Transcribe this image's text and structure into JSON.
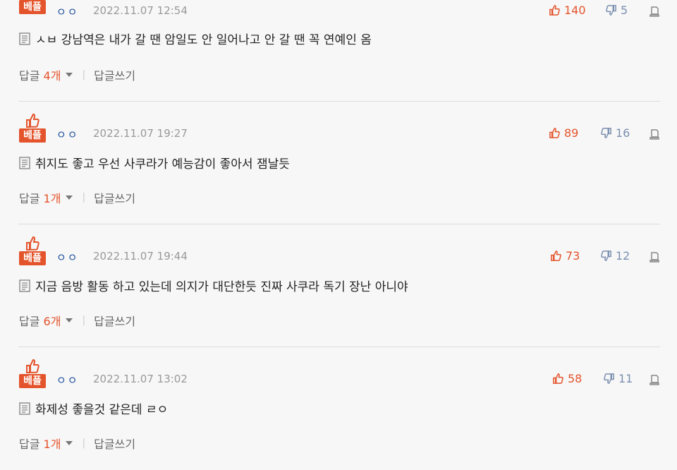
{
  "comments": [
    {
      "best_label": "베플",
      "nick": "ㅇㅇ",
      "date": "2022.11.07 12:54",
      "likes": "140",
      "dislikes": "5",
      "text": "ㅅㅂ 강남역은 내가 갈 땐 암일도 안 일어나고 안 갈 땐 꼭 연예인 옴",
      "reply_label": "답글",
      "reply_count": "4개",
      "write_reply": "답글쓰기"
    },
    {
      "best_label": "베플",
      "nick": "ㅇㅇ",
      "date": "2022.11.07 19:27",
      "likes": "89",
      "dislikes": "16",
      "text": "취지도 좋고 우선 사쿠라가 예능감이 좋아서 잼날듯",
      "reply_label": "답글",
      "reply_count": "1개",
      "write_reply": "답글쓰기"
    },
    {
      "best_label": "베플",
      "nick": "ㅇㅇ",
      "date": "2022.11.07 19:44",
      "likes": "73",
      "dislikes": "12",
      "text": "지금 음방 활동 하고 있는데 의지가 대단한듯 진짜 사쿠라 독기 장난 아니야",
      "reply_label": "답글",
      "reply_count": "6개",
      "write_reply": "답글쓰기"
    },
    {
      "best_label": "베플",
      "nick": "ㅇㅇ",
      "date": "2022.11.07 13:02",
      "likes": "58",
      "dislikes": "11",
      "text": "화제성 좋을것 같은데 ㄹㅇ",
      "reply_label": "답글",
      "reply_count": "1개",
      "write_reply": "답글쓰기"
    }
  ],
  "colors": {
    "accent": "#e4542c",
    "nick": "#1f4f9c",
    "muted": "#999999",
    "dislike": "#7b8fb0",
    "background": "#f7f7f7"
  },
  "icons": {
    "like": "thumbs-up-icon",
    "dislike": "thumbs-down-icon",
    "report": "report-icon",
    "document": "document-icon",
    "dropdown": "caret-down-icon"
  }
}
